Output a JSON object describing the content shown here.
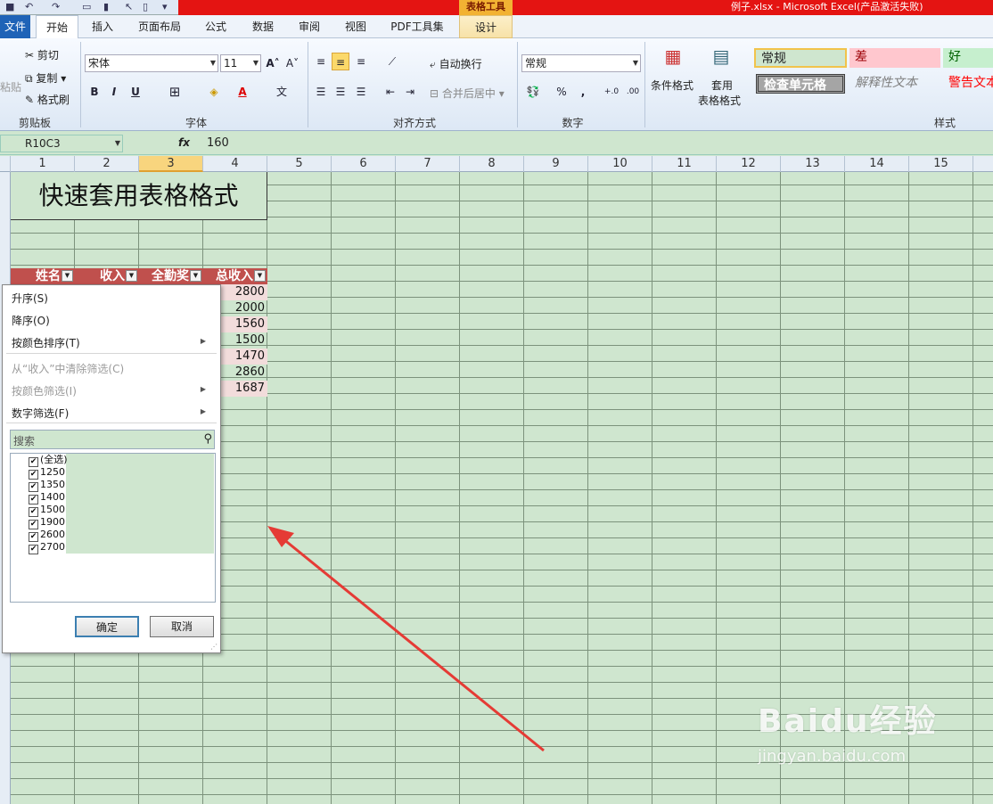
{
  "window": {
    "context_tab_title": "表格工具",
    "title": "例子.xlsx  -  Microsoft Excel(产品激活失败)"
  },
  "tabs": [
    "文件",
    "开始",
    "插入",
    "页面布局",
    "公式",
    "数据",
    "审阅",
    "视图",
    "PDF工具集",
    "设计"
  ],
  "ribbon": {
    "clipboard": {
      "paste": "粘贴",
      "cut": "剪切",
      "copy": "复制",
      "format_painter": "格式刷",
      "label": "剪贴板"
    },
    "font": {
      "name": "宋体",
      "size": "11",
      "label": "字体"
    },
    "alignment": {
      "wrap": "自动换行",
      "merge": "合并后居中",
      "label": "对齐方式"
    },
    "number": {
      "format": "常规",
      "label": "数字"
    },
    "styles": {
      "conditional": "条件格式",
      "table_fmt_1": "套用",
      "table_fmt_2": "表格格式",
      "label": "样式",
      "cells": [
        "常规",
        "差",
        "好",
        "检查单元格",
        "解释性文本",
        "警告文本"
      ]
    }
  },
  "formula_bar": {
    "name_box": "R10C3",
    "fx": "fx",
    "value": "160"
  },
  "columns": [
    "1",
    "2",
    "3",
    "4",
    "5",
    "6",
    "7",
    "8",
    "9",
    "10",
    "11",
    "12",
    "13",
    "14",
    "15"
  ],
  "sheet": {
    "title": "快速套用表格格式",
    "headers": [
      "姓名",
      "收入",
      "全勤奖",
      "总收入"
    ],
    "totals": [
      "2800",
      "2000",
      "1560",
      "1500",
      "1470",
      "2860",
      "1687"
    ]
  },
  "filter_menu": {
    "sort_asc": "升序(S)",
    "sort_desc": "降序(O)",
    "sort_by_color": "按颜色排序(T)",
    "clear_filter": "从“收入”中清除筛选(C)",
    "filter_by_color": "按颜色筛选(I)",
    "number_filter": "数字筛选(F)",
    "search_placeholder": "搜索",
    "items": [
      "(全选)",
      "1250",
      "1350",
      "1400",
      "1500",
      "1900",
      "2600",
      "2700"
    ],
    "ok": "确定",
    "cancel": "取消"
  },
  "watermark": {
    "text1": "Baidu经验",
    "text2": "jingyan.baidu.com"
  },
  "colors": {
    "header_red": "#c0504d",
    "sheet_green": "#cfe6cf",
    "arrow": "#e53b35",
    "title_red": "#e41412"
  }
}
